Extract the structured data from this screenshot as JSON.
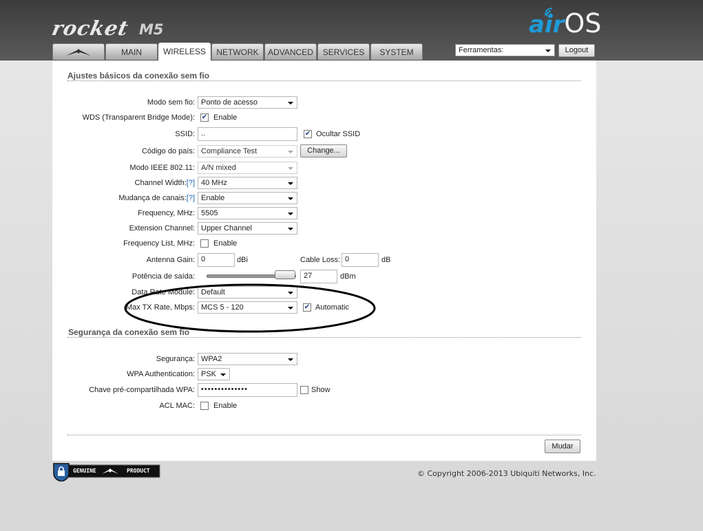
{
  "brand": {
    "product": "rocket",
    "model": "M5",
    "os_air": "air",
    "os_name": "OS",
    "tm": "™"
  },
  "tabs": [
    {
      "id": "logo",
      "label": ""
    },
    {
      "id": "main",
      "label": "MAIN"
    },
    {
      "id": "wireless",
      "label": "WIRELESS"
    },
    {
      "id": "network",
      "label": "NETWORK"
    },
    {
      "id": "advanced",
      "label": "ADVANCED"
    },
    {
      "id": "services",
      "label": "SERVICES"
    },
    {
      "id": "system",
      "label": "SYSTEM"
    }
  ],
  "active_tab": "WIRELESS",
  "tools": {
    "selected": "Ferramentas:",
    "logout": "Logout"
  },
  "basic": {
    "title": "Ajustes básicos da conexão sem fio",
    "wireless_mode": {
      "label": "Modo sem fio:",
      "value": "Ponto de acesso"
    },
    "wds": {
      "label": "WDS (Transparent Bridge Mode):",
      "checked": true,
      "text": "Enable"
    },
    "ssid": {
      "label": "SSID:",
      "value": "..",
      "hide_checked": true,
      "hide_text": "Ocultar SSID"
    },
    "country": {
      "label": "Código do país:",
      "value": "Compliance Test",
      "button": "Change..."
    },
    "ieee": {
      "label": "Modo IEEE 802.11:",
      "value": "A/N mixed"
    },
    "channel_width": {
      "label": "Channel Width:",
      "help": "[?]",
      "value": "40 MHz"
    },
    "channel_shifting": {
      "label": "Mudança de canais:",
      "help": "[?]",
      "value": "Enable"
    },
    "frequency": {
      "label": "Frequency, MHz:",
      "value": "5505"
    },
    "extension_channel": {
      "label": "Extension Channel:",
      "value": "Upper Channel"
    },
    "frequency_list": {
      "label": "Frequency List, MHz:",
      "checked": false,
      "text": "Enable"
    },
    "antenna_gain": {
      "label": "Antenna Gain:",
      "value": "0",
      "unit": "dBi"
    },
    "cable_loss": {
      "label": "Cable Loss:",
      "value": "0",
      "unit": "dB"
    },
    "output_power": {
      "label": "Potência de saída:",
      "value": "27",
      "unit": "dBm",
      "slider_fraction": 0.78
    },
    "data_rate_module": {
      "label": "Data Rate Module:",
      "value": "Default"
    },
    "max_tx_rate": {
      "label": "Max TX Rate, Mbps:",
      "value": "MCS 5 - 120",
      "auto_checked": true,
      "auto_text": "Automatic"
    }
  },
  "security": {
    "title": "Segurança da conexão sem fio",
    "security": {
      "label": "Segurança:",
      "value": "WPA2"
    },
    "wpa_auth": {
      "label": "WPA Authentication:",
      "value": "PSK"
    },
    "psk": {
      "label": "Chave pré-compartilhada WPA:",
      "value": "••••••••••••••",
      "show_checked": false,
      "show_text": "Show"
    },
    "acl": {
      "label": "ACL MAC:",
      "checked": false,
      "text": "Enable"
    }
  },
  "actions": {
    "apply": "Mudar"
  },
  "footer": {
    "badge_left": "GENUINE",
    "badge_right": "PRODUCT",
    "copyright": "© Copyright 2006-2013 Ubiquiti Networks, Inc."
  },
  "colors": {
    "accent": "#1e9ad8",
    "header": "#4a4a4a",
    "help_link": "#1e63b8"
  }
}
